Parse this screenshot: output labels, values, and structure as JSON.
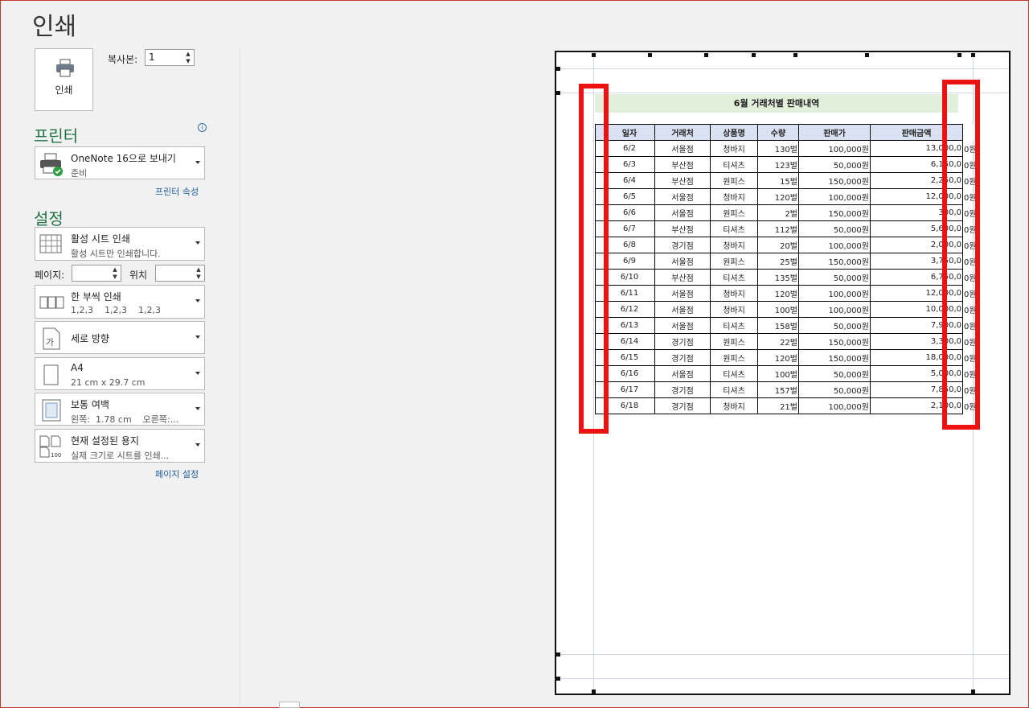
{
  "title": "인쇄",
  "print_button": {
    "label": "인쇄",
    "icon": "printer-icon"
  },
  "copies": {
    "label": "복사본:",
    "value": "1"
  },
  "printer": {
    "heading": "프린터",
    "name": "OneNote 16으로 보내기",
    "status": "준비",
    "properties_link": "프린터 속성"
  },
  "settings": {
    "heading": "설정",
    "scope": {
      "title": "활성 시트 인쇄",
      "sub": "활성 시트만 인쇄합니다."
    },
    "pages_label": "페이지:",
    "to_label": "위치",
    "collate": {
      "title": "한 부씩 인쇄",
      "sub": "1,2,3    1,2,3    1,2,3"
    },
    "orientation": {
      "title": "세로 방향"
    },
    "paper": {
      "title": "A4",
      "sub": "21 cm x 29.7 cm"
    },
    "margins": {
      "title": "보통 여백",
      "sub": "왼쪽:  1.78 cm    오른쪽:..."
    },
    "scaling": {
      "title": "현재 설정된 용지",
      "sub": "실제 크기로 시트를 인쇄..."
    },
    "page_setup_link": "페이지 설정"
  },
  "preview": {
    "sheet_title": "6월  거래처별 판매내역",
    "columns": [
      "일자",
      "거래처",
      "상품명",
      "수량",
      "판매가",
      "판매금액"
    ],
    "rows": [
      [
        "6/2",
        "서울점",
        "청바지",
        "130벌",
        "100,000원",
        "13,000,0",
        "0원"
      ],
      [
        "6/3",
        "부산점",
        "티셔츠",
        "123벌",
        "50,000원",
        "6,150,0",
        "0원"
      ],
      [
        "6/4",
        "부산점",
        "원피스",
        "15벌",
        "150,000원",
        "2,250,0",
        "0원"
      ],
      [
        "6/5",
        "서울점",
        "청바지",
        "120벌",
        "100,000원",
        "12,000,0",
        "0원"
      ],
      [
        "6/6",
        "서울점",
        "원피스",
        "2벌",
        "150,000원",
        "300,0",
        "0원"
      ],
      [
        "6/7",
        "부산점",
        "티셔츠",
        "112벌",
        "50,000원",
        "5,600,0",
        "0원"
      ],
      [
        "6/8",
        "경기점",
        "청바지",
        "20벌",
        "100,000원",
        "2,000,0",
        "0원"
      ],
      [
        "6/9",
        "서울점",
        "원피스",
        "25벌",
        "150,000원",
        "3,750,0",
        "0원"
      ],
      [
        "6/10",
        "부산점",
        "티셔츠",
        "135벌",
        "50,000원",
        "6,750,0",
        "0원"
      ],
      [
        "6/11",
        "서울점",
        "청바지",
        "120벌",
        "100,000원",
        "12,000,0",
        "0원"
      ],
      [
        "6/12",
        "서울점",
        "청바지",
        "100벌",
        "100,000원",
        "10,000,0",
        "0원"
      ],
      [
        "6/13",
        "서울점",
        "티셔츠",
        "158벌",
        "50,000원",
        "7,900,0",
        "0원"
      ],
      [
        "6/14",
        "경기점",
        "원피스",
        "22벌",
        "150,000원",
        "3,300,0",
        "0원"
      ],
      [
        "6/15",
        "경기점",
        "원피스",
        "120벌",
        "150,000원",
        "18,000,0",
        "0원"
      ],
      [
        "6/16",
        "서울점",
        "티셔츠",
        "100벌",
        "50,000원",
        "5,000,0",
        "0원"
      ],
      [
        "6/17",
        "경기점",
        "티셔츠",
        "157벌",
        "50,000원",
        "7,850,0",
        "0원"
      ],
      [
        "6/18",
        "경기점",
        "청바지",
        "21벌",
        "100,000원",
        "2,100,0",
        "0원"
      ]
    ]
  },
  "colors": {
    "accent_green": "#217346",
    "highlight_red": "#ee1111",
    "header_blue": "#d9e1f2",
    "title_green": "#e2efda"
  }
}
